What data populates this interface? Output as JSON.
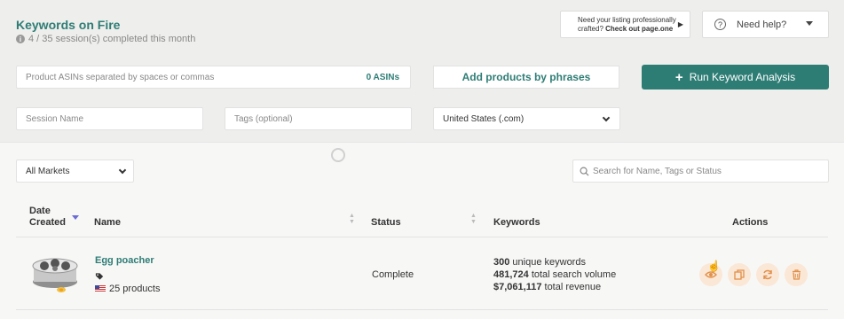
{
  "header": {
    "title": "Keywords on Fire",
    "sessions": "4 / 35 session(s) completed this month",
    "promo_line1": "Need your listing professionally",
    "promo_line2_prefix": "crafted? ",
    "promo_link": "Check out page.one",
    "help_label": "Need help?"
  },
  "form": {
    "asin_placeholder": "Product ASINs separated by spaces or commas",
    "asin_count": "0 ASINs",
    "phrases_label": "Add products by phrases",
    "run_label": "Run Keyword Analysis",
    "session_placeholder": "Session Name",
    "tags_placeholder": "Tags (optional)",
    "marketplace": "United States (.com)"
  },
  "filters": {
    "markets": "All Markets",
    "search_placeholder": "Search for Name, Tags or Status"
  },
  "table": {
    "headers": {
      "date_line1": "Date",
      "date_line2": "Created",
      "name": "Name",
      "status": "Status",
      "keywords": "Keywords",
      "actions": "Actions"
    },
    "rows": [
      {
        "name": "Egg poacher",
        "products": "25 products",
        "status": "Complete",
        "unique_count": "300",
        "unique_label": " unique keywords",
        "volume": "481,724",
        "volume_label": " total search volume",
        "revenue": "$7,061,117",
        "revenue_label": " total revenue"
      }
    ]
  },
  "icons": {
    "actions": [
      "eye-icon",
      "copy-icon",
      "refresh-icon",
      "trash-icon"
    ]
  },
  "colors": {
    "accent": "#2e7d75",
    "action_bg": "#fbe7d6",
    "action_fg": "#e0904a"
  }
}
